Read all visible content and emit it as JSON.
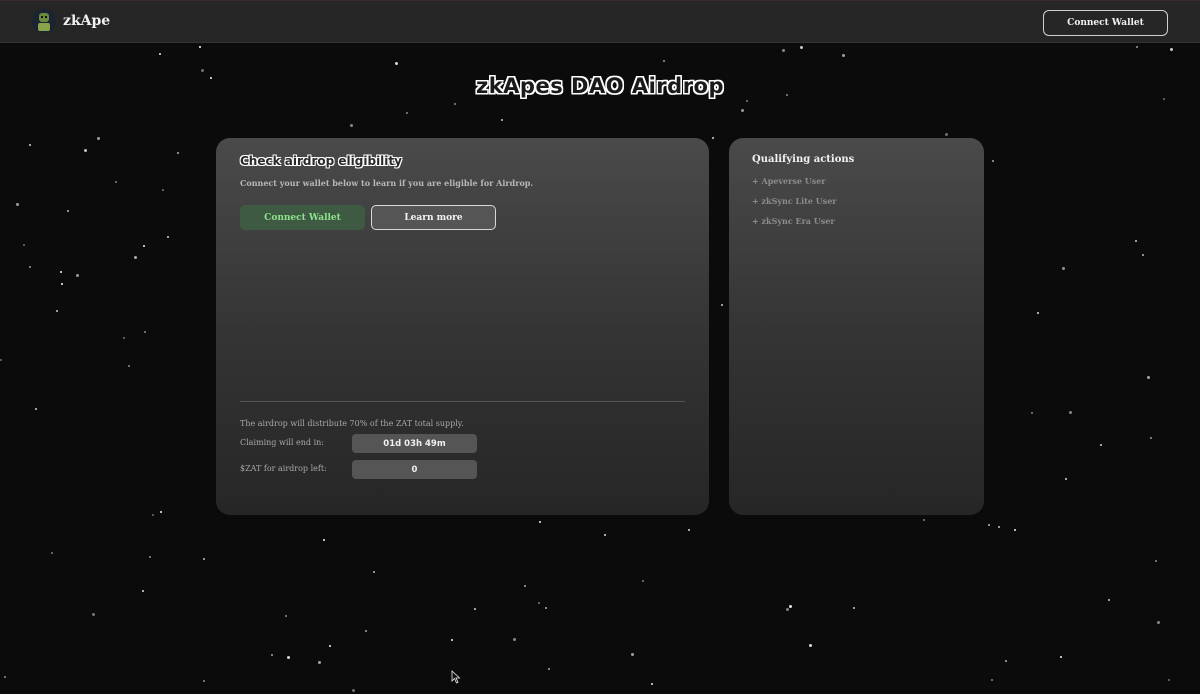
{
  "header": {
    "brand": "zkApe",
    "connect_label": "Connect Wallet"
  },
  "page": {
    "title": "zkApes DAO Airdrop"
  },
  "eligibility": {
    "title": "Check airdrop eligibility",
    "subtitle": "Connect your wallet below to learn if you are eligible for Airdrop.",
    "connect_label": "Connect Wallet",
    "learn_more_label": "Learn more",
    "supply_text": "The airdrop will distribute 70% of the ZAT total supply.",
    "claim_label": "Claiming will end in:",
    "claim_value": "01d 03h 49m",
    "left_label": "$ZAT for airdrop left:",
    "left_value": "0"
  },
  "qualifying": {
    "title": "Qualifying actions",
    "items": [
      "+ Apeverse User",
      "+ zkSync Lite User",
      "+ zkSync Era User"
    ]
  },
  "colors": {
    "background": "#0b0b0b",
    "topbar": "#262626",
    "accent_green": "#8fe28f",
    "connect_bg": "#3f5a42"
  }
}
